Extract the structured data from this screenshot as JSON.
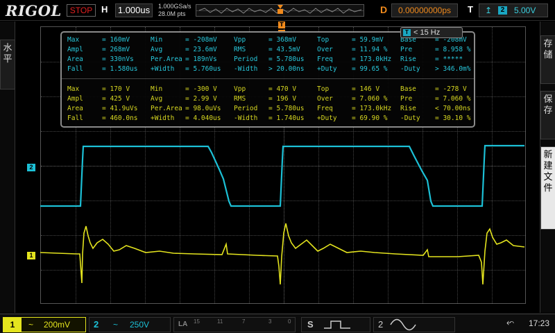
{
  "header": {
    "brand": "RIGOL",
    "run_state": "STOP",
    "horizontal_label": "H",
    "timebase": "1.000us",
    "sample_rate": "1.000GSa/s",
    "memory_depth": "28.0M pts",
    "delay_label": "D",
    "delay": "0.00000000ps",
    "trigger_label": "T",
    "trigger_channel": "2",
    "trigger_level": "5.00V",
    "trigger_edge_icon": "rising-edge-icon"
  },
  "left_panel": {
    "label": "水平"
  },
  "right_panel": {
    "btn1": "存储",
    "btn2": "保存",
    "btn3": "新建文件"
  },
  "freq_counter": {
    "channel": "T",
    "value": "< 15 Hz"
  },
  "colors": {
    "ch1": "#e4e41e",
    "ch2": "#1cc0d6",
    "trigger": "#f08a1c"
  },
  "measurements": {
    "ch2": [
      [
        [
          "Max",
          "= 160mV"
        ],
        [
          "Min",
          "= -208mV"
        ],
        [
          "Vpp",
          "= 368mV"
        ],
        [
          "Top",
          "= 59.9mV"
        ],
        [
          "Base",
          "= -208mV"
        ]
      ],
      [
        [
          "Ampl",
          "= 268mV"
        ],
        [
          "Avg",
          "= 23.6mV"
        ],
        [
          "RMS",
          "= 43.5mV"
        ],
        [
          "Over",
          "= 11.94 %"
        ],
        [
          "Pre",
          "= 8.958 %"
        ]
      ],
      [
        [
          "Area",
          "= 330nVs"
        ],
        [
          "Per.Area",
          "= 189nVs"
        ],
        [
          "Period",
          "= 5.780us"
        ],
        [
          "Freq",
          "= 173.0kHz"
        ],
        [
          "Rise",
          "= *****"
        ]
      ],
      [
        [
          "Fall",
          "= 1.580us"
        ],
        [
          "+Width",
          "= 5.760us"
        ],
        [
          "-Width",
          "> 20.00ns"
        ],
        [
          "+Duty",
          "= 99.65 %"
        ],
        [
          "-Duty",
          "> 346.0m%"
        ]
      ]
    ],
    "ch1": [
      [
        [
          "Max",
          "= 170 V"
        ],
        [
          "Min",
          "= -300 V"
        ],
        [
          "Vpp",
          "= 470 V"
        ],
        [
          "Top",
          "= 146 V"
        ],
        [
          "Base",
          "= -278 V"
        ]
      ],
      [
        [
          "Ampl",
          "= 425 V"
        ],
        [
          "Avg",
          "= 2.99 V"
        ],
        [
          "RMS",
          "= 196 V"
        ],
        [
          "Over",
          "= 7.060 %"
        ],
        [
          "Pre",
          "= 7.060 %"
        ]
      ],
      [
        [
          "Area",
          "= 41.9uVs"
        ],
        [
          "Per.Area",
          "= 98.0uVs"
        ],
        [
          "Period",
          "= 5.780us"
        ],
        [
          "Freq",
          "= 173.0kHz"
        ],
        [
          "Rise",
          "< 70.00ns"
        ]
      ],
      [
        [
          "Fall",
          "= 460.0ns"
        ],
        [
          "+Width",
          "= 4.040us"
        ],
        [
          "-Width",
          "= 1.740us"
        ],
        [
          "+Duty",
          "= 69.90 %"
        ],
        [
          "-Duty",
          "= 30.10 %"
        ]
      ]
    ]
  },
  "channels": {
    "ch1": {
      "number": "1",
      "coupling": "~",
      "scale": "200mV"
    },
    "ch2": {
      "number": "2",
      "coupling": "~",
      "scale": "250V"
    }
  },
  "la": {
    "label": "LA",
    "digits": [
      "15",
      "11",
      "7",
      "3",
      "0"
    ]
  },
  "bus_s": {
    "label": "S"
  },
  "bus_2": {
    "label": "2"
  },
  "status": {
    "time": "17:23",
    "usb_icon": "usb-icon"
  }
}
